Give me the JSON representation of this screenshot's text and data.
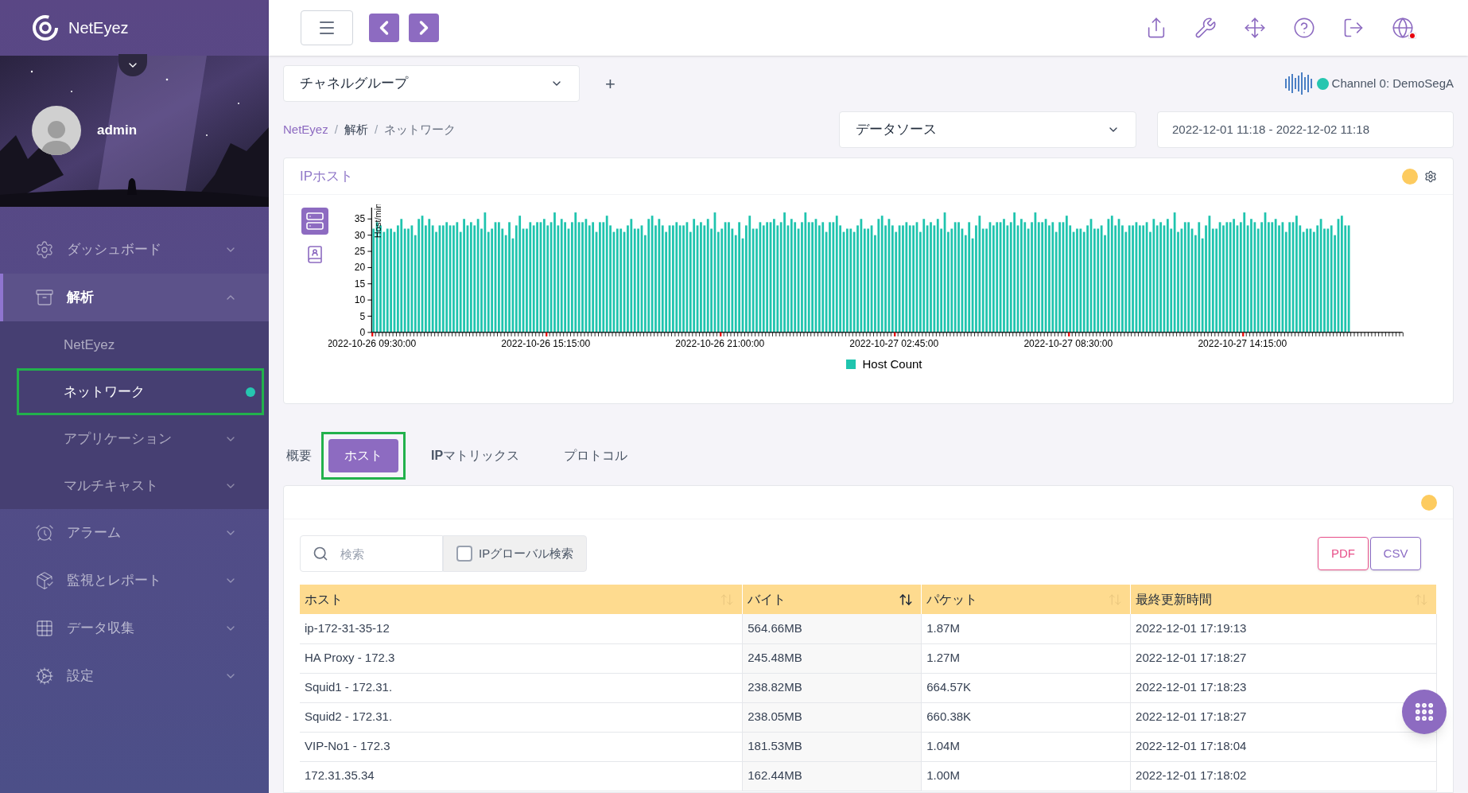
{
  "app": {
    "name": "NetEyez"
  },
  "user": {
    "name": "admin"
  },
  "sidebar": {
    "items": [
      {
        "label": "ダッシュボード",
        "expanded": false,
        "selected": false
      },
      {
        "label": "解析",
        "expanded": true,
        "selected": true,
        "children": [
          {
            "label": "NetEyez",
            "selected": false
          },
          {
            "label": "ネットワーク",
            "selected": true,
            "highlighted": true
          },
          {
            "label": "アプリケーション",
            "selected": false,
            "expanded": false
          },
          {
            "label": "マルチキャスト",
            "selected": false,
            "expanded": false
          }
        ]
      },
      {
        "label": "アラーム",
        "expanded": false,
        "selected": false
      },
      {
        "label": "監視とレポート",
        "expanded": false,
        "selected": false
      },
      {
        "label": "データ収集",
        "expanded": false,
        "selected": false
      },
      {
        "label": "設定",
        "expanded": false,
        "selected": false
      }
    ]
  },
  "channel_group": {
    "value": "チャネルグループ",
    "add": "+"
  },
  "channel": {
    "label": "Channel 0: DemoSegA",
    "color": "#26c6b0"
  },
  "breadcrumb": {
    "items": [
      "NetEyez",
      "解析",
      "ネットワーク"
    ],
    "separator": "/"
  },
  "datasource": {
    "value": "データソース"
  },
  "date_range": {
    "value": "2022-12-01 11:18 - 2022-12-02 11:18"
  },
  "chart_panel": {
    "title": "IPホスト",
    "warning": true,
    "views": [
      {
        "selected": true
      },
      {
        "selected": false
      }
    ],
    "time_labels": [
      "2022-10-26 09:30:00",
      "2022-10-26 15:15:00",
      "2022-10-26 21:00:00",
      "2022-10-27 02:45:00",
      "2022-10-27 08:30:00",
      "2022-10-27 14:15:00"
    ],
    "chart_data": {
      "type": "bar",
      "ylabel": "Host/min",
      "ylim": [
        0,
        38
      ],
      "yticks": [
        0,
        5,
        10,
        15,
        20,
        25,
        30,
        35
      ],
      "series": [
        {
          "name": "Host Count",
          "color": "#1fc4ae",
          "values": [
            32,
            34,
            33,
            31,
            32,
            32,
            31,
            33,
            35,
            32,
            32,
            33,
            30,
            35,
            36,
            33,
            35,
            33,
            31,
            33,
            33,
            34,
            33,
            33,
            34,
            31,
            35,
            33,
            34,
            33,
            35,
            32,
            37,
            31,
            32,
            34,
            34,
            32,
            30,
            34,
            29,
            33,
            36,
            32,
            32,
            34,
            33,
            34,
            34,
            35,
            33,
            34,
            37,
            33,
            35,
            34,
            32,
            34,
            37,
            34,
            34,
            35,
            33,
            34,
            31,
            34,
            34,
            36,
            33,
            31,
            32,
            32,
            31,
            33,
            35,
            32,
            32,
            33,
            30,
            35,
            36,
            33,
            35,
            33,
            31,
            33,
            33,
            34,
            33,
            33,
            34,
            31,
            35,
            33,
            34,
            33,
            35,
            32,
            37,
            31,
            32,
            34,
            34,
            32,
            30,
            34,
            29,
            33,
            36,
            32,
            32,
            34,
            33,
            34,
            34,
            35,
            33,
            34,
            37,
            33,
            35,
            34,
            32,
            34,
            37,
            34,
            34,
            35,
            33,
            34,
            31,
            34,
            34,
            36,
            33,
            31,
            32,
            32,
            31,
            33,
            35,
            32,
            32,
            33,
            30,
            35,
            36,
            33,
            35,
            33,
            31,
            33,
            33,
            34,
            33,
            33,
            34,
            31,
            35,
            33,
            34,
            33,
            35,
            32,
            37,
            31,
            32,
            34,
            34,
            32,
            30,
            34,
            29,
            33,
            36,
            32,
            32,
            34,
            33,
            34,
            34,
            35,
            33,
            34,
            37,
            33,
            35,
            34,
            32,
            34,
            37,
            34,
            34,
            35,
            33,
            34,
            31,
            34,
            34,
            36,
            33,
            31,
            32,
            32,
            31,
            33,
            35,
            32,
            32,
            33,
            30,
            35,
            36,
            33,
            35,
            33,
            31,
            33,
            33,
            34,
            33,
            33,
            34,
            31,
            35,
            33,
            34,
            33,
            35,
            32,
            37,
            31,
            32,
            34,
            34,
            32,
            30,
            34,
            29,
            33,
            36,
            32,
            32,
            34,
            33,
            34,
            34,
            35,
            33,
            34,
            37,
            33,
            35,
            34,
            32,
            34,
            37,
            34,
            34,
            35,
            33,
            34,
            31,
            34,
            34,
            36,
            33,
            31,
            32,
            32,
            31,
            33,
            35,
            32,
            32,
            33,
            30,
            35,
            36,
            33,
            33
          ]
        }
      ]
    }
  },
  "tabs": [
    {
      "label": "概要",
      "selected": false
    },
    {
      "label": "ホスト",
      "selected": true,
      "highlighted": true
    },
    {
      "label": "**IP**マトリックス",
      "selected": false
    },
    {
      "label": "プロトコル",
      "selected": false
    }
  ],
  "table_panel": {
    "warning": true,
    "search": {
      "placeholder": "検索"
    },
    "global_search": {
      "label": "IPグローバル検索",
      "checked": false
    },
    "buttons": [
      {
        "label": "PDF",
        "color": "#e8508a"
      },
      {
        "label": "CSV",
        "color": "#8b6cc4"
      }
    ],
    "columns": [
      {
        "label": "ホスト",
        "sorted": false
      },
      {
        "label": "バイト",
        "sorted": true
      },
      {
        "label": "パケット",
        "sorted": false
      },
      {
        "label": "最終更新時間",
        "sorted": false
      }
    ],
    "rows": [
      [
        "ip-172-31-35-12",
        "564.66MB",
        "1.87M",
        "2022-12-01 17:19:13"
      ],
      [
        "HA Proxy - 172.3",
        "245.48MB",
        "1.27M",
        "2022-12-01 17:18:27"
      ],
      [
        "Squid1 - 172.31.",
        "238.82MB",
        "664.57K",
        "2022-12-01 17:18:23"
      ],
      [
        "Squid2 - 172.31.",
        "238.05MB",
        "660.38K",
        "2022-12-01 17:18:27"
      ],
      [
        "VIP-No1 - 172.3",
        "181.53MB",
        "1.04M",
        "2022-12-01 17:18:04"
      ],
      [
        "172.31.35.34",
        "162.44MB",
        "1.00M",
        "2022-12-01 17:18:02"
      ]
    ]
  }
}
